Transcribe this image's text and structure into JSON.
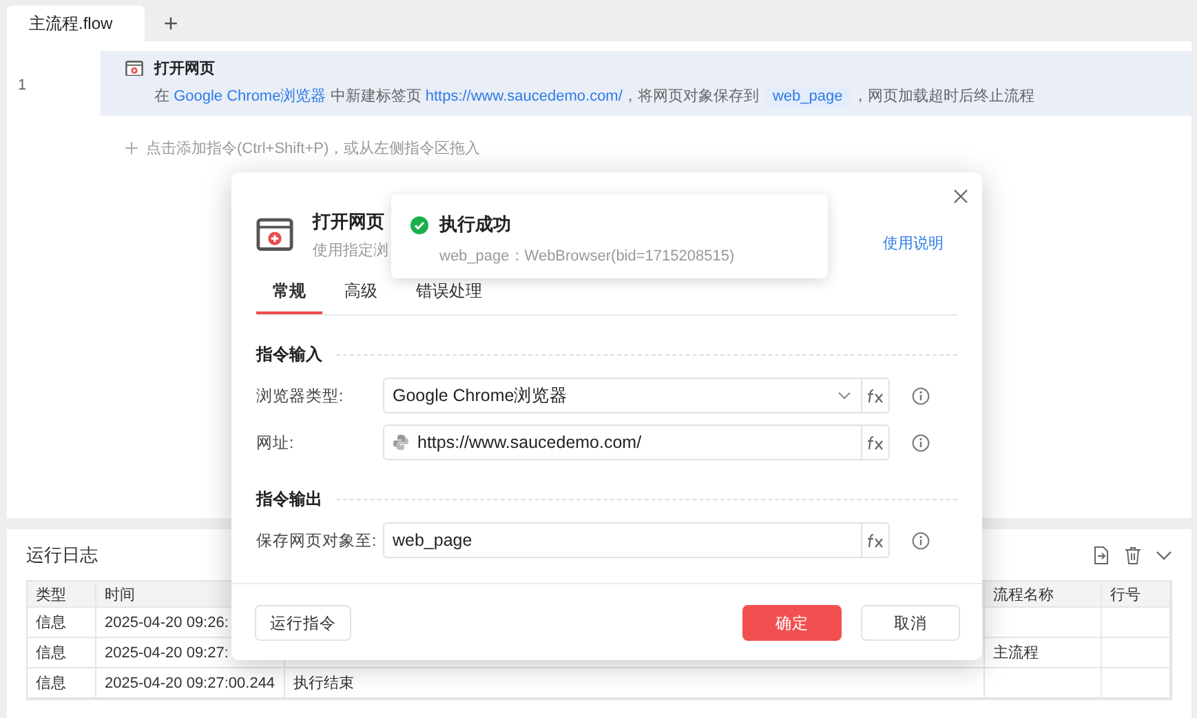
{
  "file_tabs": [
    {
      "label": "主流程.flow",
      "selected": true
    }
  ],
  "add_tab": "+",
  "steps": [
    {
      "line": "1",
      "title": "打开网页",
      "selected": true,
      "segments": [
        {
          "kind": "text",
          "text": "在 "
        },
        {
          "kind": "value",
          "text": "Google Chrome浏览器"
        },
        {
          "kind": "text",
          "text": " 中新建标签页 "
        },
        {
          "kind": "value",
          "text": "https://www.saucedemo.com/"
        },
        {
          "kind": "text",
          "text": "，将网页对象保存到 "
        },
        {
          "kind": "variable",
          "text": "web_page"
        },
        {
          "kind": "text",
          "text": "，网页加载超时后终止流程"
        }
      ]
    }
  ],
  "add_hint": "点击添加指令(Ctrl+Shift+P)，或从左侧指令区拖入",
  "log": {
    "title": "运行日志",
    "columns": [
      {
        "label": "类型"
      },
      {
        "label": "时间"
      },
      {},
      {
        "label": "流程名称"
      },
      {
        "label": "行号"
      }
    ],
    "rows": [
      {
        "type": "信息",
        "time": "2025-04-20 09:26:"
      },
      {
        "type": "信息",
        "time": "2025-04-20 09:27:",
        "flow": "主流程"
      },
      {
        "type": "信息",
        "time": "2025-04-20 09:27:00.244",
        "message": "执行结束"
      }
    ]
  },
  "dialog": {
    "title": "打开网页",
    "subtitle": "使用指定浏",
    "help_link": "使用说明",
    "tabs": [
      {
        "label": "常规",
        "selected": true
      },
      {
        "label": "高级",
        "selected": false
      },
      {
        "label": "错误处理",
        "selected": false
      }
    ],
    "sections": [
      {
        "title": "指令输入",
        "fields": [
          {
            "label": "浏览器类型:",
            "value": "Google Chrome浏览器",
            "kind": "select"
          },
          {
            "label": "网址:",
            "value": "https://www.saucedemo.com/",
            "kind": "python"
          }
        ]
      },
      {
        "title": "指令输出",
        "fields": [
          {
            "label": "保存网页对象至:",
            "value": "web_page",
            "kind": "text"
          }
        ]
      }
    ],
    "run_button": "运行指令",
    "confirm_button": "确定",
    "cancel_button": "取消"
  },
  "toast": {
    "title": "执行成功",
    "detail": "web_page：WebBrowser(bid=1715208515)"
  }
}
